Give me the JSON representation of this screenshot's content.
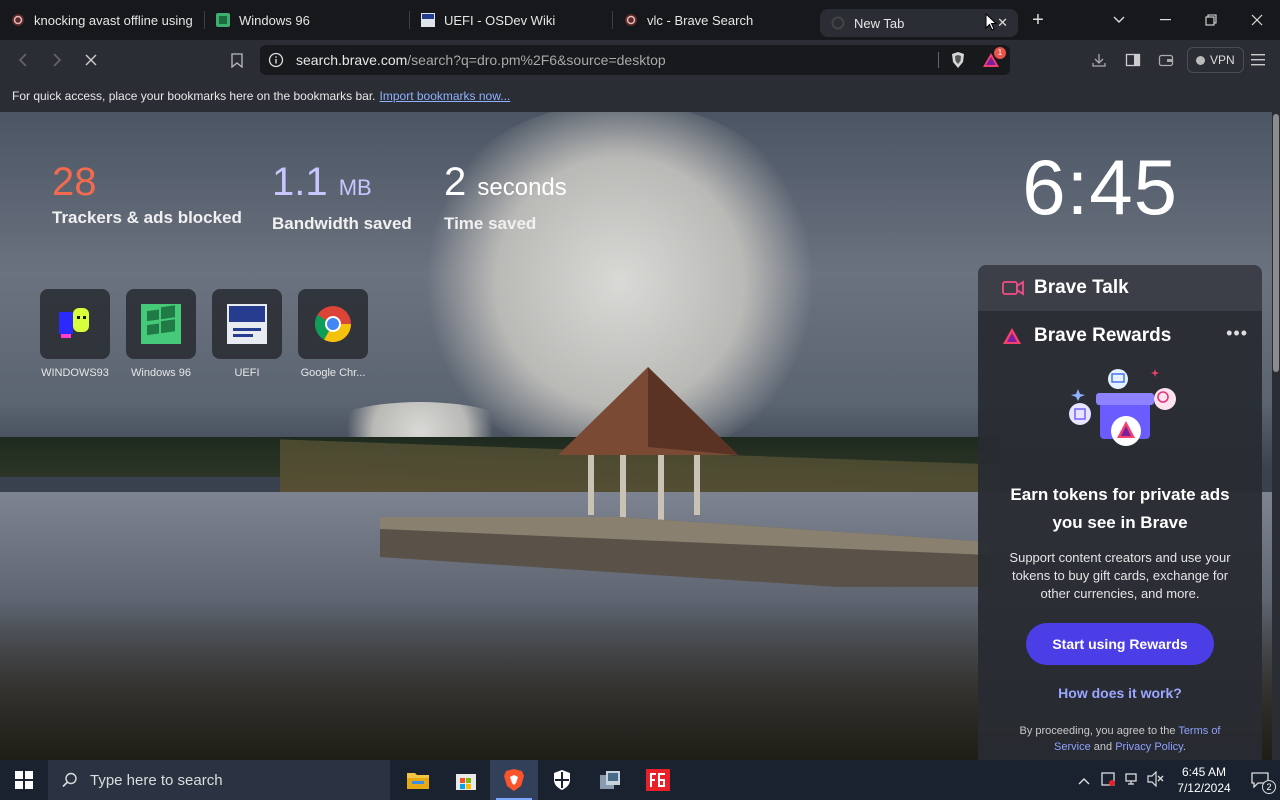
{
  "tabs": [
    {
      "title": "knocking avast offline using ta",
      "active": false
    },
    {
      "title": "Windows 96",
      "active": false
    },
    {
      "title": "UEFI - OSDev Wiki",
      "active": false
    },
    {
      "title": "vlc - Brave Search",
      "active": false
    },
    {
      "title": "New Tab",
      "active": true
    }
  ],
  "new_tab_symbol": "+",
  "toolbar": {
    "url_host": "search.brave.com",
    "url_path": "/search?q=dro.pm%2F6&source=desktop",
    "vpn_label": "VPN",
    "rewards_badge": "1"
  },
  "bookmarks_bar": {
    "text": "For quick access, place your bookmarks here on the bookmarks bar.",
    "link": "Import bookmarks now..."
  },
  "stats": {
    "trackers": {
      "value": "28",
      "label": "Trackers & ads blocked"
    },
    "bandwidth": {
      "value": "1.1",
      "unit": "MB",
      "label": "Bandwidth saved"
    },
    "time": {
      "value": "2",
      "unit": "seconds",
      "label": "Time saved"
    }
  },
  "clock": "6:45",
  "top_sites": [
    {
      "name": "WINDOWS93"
    },
    {
      "name": "Windows 96"
    },
    {
      "name": "UEFI"
    },
    {
      "name": "Google Chr..."
    }
  ],
  "brave_talk": {
    "title": "Brave Talk"
  },
  "brave_rewards": {
    "title": "Brave Rewards",
    "more": "•••",
    "heading": "Earn tokens for private ads you see in Brave",
    "description": "Support content creators and use your tokens to buy gift cards, exchange for other currencies, and more.",
    "cta": "Start using Rewards",
    "how": "How does it work?",
    "legal_prefix": "By proceeding, you agree to the",
    "terms": "Terms of Service",
    "and": "and",
    "privacy": "Privacy Policy",
    "period": "."
  },
  "taskbar": {
    "search_placeholder": "Type here to search",
    "time": "6:45 AM",
    "date": "7/12/2024",
    "notifications": "2"
  },
  "colors": {
    "trackers": "#f36b4f",
    "bandwidth": "#c9c6ff",
    "accent": "#4c3ee6",
    "link": "#9ba6ff"
  }
}
